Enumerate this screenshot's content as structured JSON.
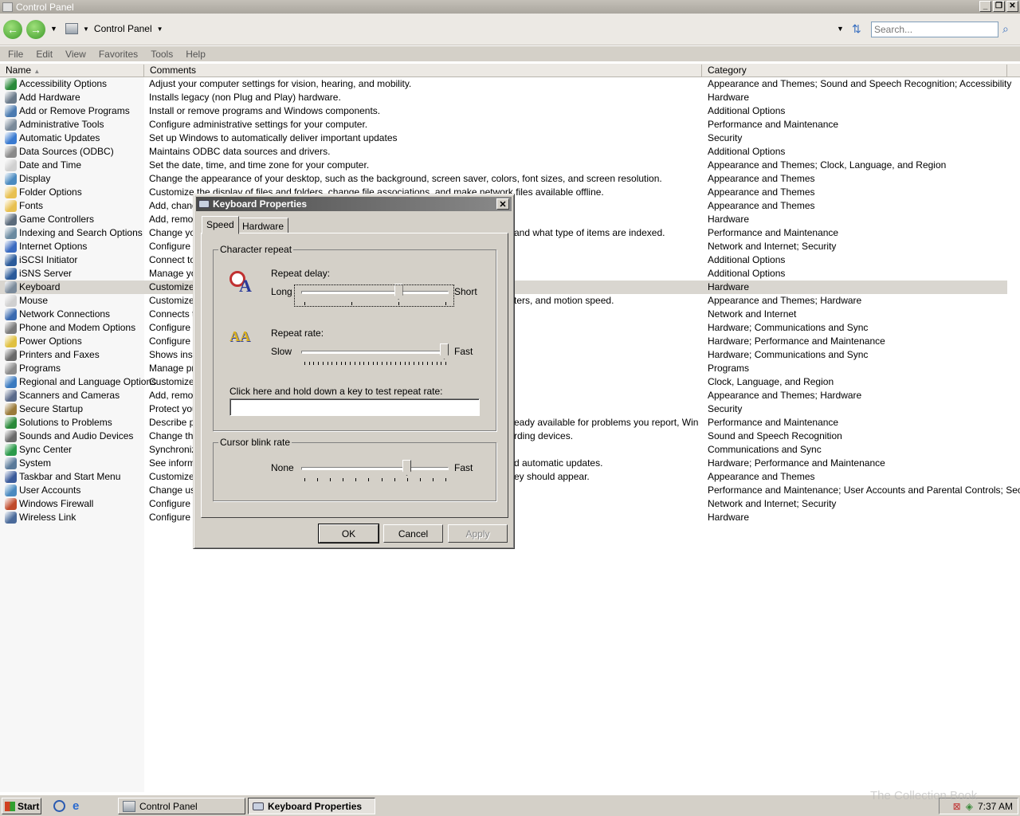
{
  "window": {
    "title": "Control Panel"
  },
  "address": {
    "path": "Control Panel",
    "search_placeholder": "Search..."
  },
  "menu": [
    "File",
    "Edit",
    "View",
    "Favorites",
    "Tools",
    "Help"
  ],
  "columns": {
    "name": "Name",
    "comments": "Comments",
    "category": "Category"
  },
  "items": [
    {
      "name": "Accessibility Options",
      "comment": "Adjust your computer settings for vision, hearing, and mobility.",
      "category": "Appearance and Themes; Sound and Speech Recognition; Accessibility",
      "color": "#2a8a3a"
    },
    {
      "name": "Add Hardware",
      "comment": "Installs legacy (non Plug and Play) hardware.",
      "category": "Hardware",
      "color": "#6a7a8a"
    },
    {
      "name": "Add or Remove Programs",
      "comment": "Install or remove programs and Windows components.",
      "category": "Additional Options",
      "color": "#4a7ab0"
    },
    {
      "name": "Administrative Tools",
      "comment": "Configure administrative settings for your computer.",
      "category": "Performance and Maintenance",
      "color": "#7a8a9a"
    },
    {
      "name": "Automatic Updates",
      "comment": "Set up Windows to automatically deliver important updates",
      "category": "Security",
      "color": "#3a7ad0"
    },
    {
      "name": "Data Sources (ODBC)",
      "comment": "Maintains ODBC data sources and drivers.",
      "category": "Additional Options",
      "color": "#8a8a8a"
    },
    {
      "name": "Date and Time",
      "comment": "Set the date, time, and time zone for your computer.",
      "category": "Appearance and Themes; Clock, Language, and Region",
      "color": "#d0d0d0"
    },
    {
      "name": "Display",
      "comment": "Change the appearance of your desktop, such as the background, screen saver, colors, font sizes, and screen resolution.",
      "category": "Appearance and Themes",
      "color": "#4a8ac0"
    },
    {
      "name": "Folder Options",
      "comment": "Customize the display of files and folders, change file associations, and make network files available offline.",
      "category": "Appearance and Themes",
      "color": "#e8c050"
    },
    {
      "name": "Fonts",
      "comment": "Add, change",
      "category": "Appearance and Themes",
      "color": "#e8c050"
    },
    {
      "name": "Game Controllers",
      "comment": "Add, remov",
      "category": "Hardware",
      "color": "#5a6a7a"
    },
    {
      "name": "Indexing and Search Options",
      "comment": "Change you",
      "comment_tail": "and what type of items are indexed.",
      "category": "Performance and Maintenance",
      "color": "#6a8aa0"
    },
    {
      "name": "Internet Options",
      "comment": "Configure y",
      "category": "Network and Internet; Security",
      "color": "#3a6ac0"
    },
    {
      "name": "iSCSI Initiator",
      "comment": "Connect to",
      "category": "Additional Options",
      "color": "#2a5a9a"
    },
    {
      "name": "iSNS Server",
      "comment": "Manage you",
      "category": "Additional Options",
      "color": "#2a5a9a"
    },
    {
      "name": "Keyboard",
      "comment": "Customize y",
      "category": "Hardware",
      "color": "#7a8a9a"
    },
    {
      "name": "Mouse",
      "comment": "Customize y",
      "comment_tail": "ters, and motion speed.",
      "category": "Appearance and Themes; Hardware",
      "color": "#d0d0d0"
    },
    {
      "name": "Network Connections",
      "comment": "Connects to",
      "category": "Network and Internet",
      "color": "#3a6ab0"
    },
    {
      "name": "Phone and Modem Options",
      "comment": "Configure y",
      "category": "Hardware; Communications and Sync",
      "color": "#7a7a7a"
    },
    {
      "name": "Power Options",
      "comment": "Configure e",
      "category": "Hardware; Performance and Maintenance",
      "color": "#e0c040"
    },
    {
      "name": "Printers and Faxes",
      "comment": "Shows insta",
      "category": "Hardware; Communications and Sync",
      "color": "#6a6a6a"
    },
    {
      "name": "Programs",
      "comment": "Manage pro",
      "category": "Programs",
      "color": "#8a8a8a"
    },
    {
      "name": "Regional and Language Options",
      "comment": "Customize s",
      "category": "Clock, Language, and Region",
      "color": "#3a7ac0"
    },
    {
      "name": "Scanners and Cameras",
      "comment": "Add, remov",
      "category": "Appearance and Themes; Hardware",
      "color": "#5a6a8a"
    },
    {
      "name": "Secure Startup",
      "comment": "Protect you",
      "category": "Security",
      "color": "#9a7a3a"
    },
    {
      "name": "Solutions to Problems",
      "comment": "Describe pr",
      "comment_tail": "eady available for problems you report, Window...",
      "category": "Performance and Maintenance",
      "color": "#2a8a3a"
    },
    {
      "name": "Sounds and Audio Devices",
      "comment": "Change the",
      "comment_tail": "rding devices.",
      "category": "Sound and Speech Recognition",
      "color": "#6a6a6a"
    },
    {
      "name": "Sync Center",
      "comment": "Synchronize",
      "category": "Communications and Sync",
      "color": "#2a9a4a"
    },
    {
      "name": "System",
      "comment": "See informa",
      "comment_tail": "d automatic updates.",
      "category": "Hardware; Performance and Maintenance",
      "color": "#5a7a9a"
    },
    {
      "name": "Taskbar and Start Menu",
      "comment": "Customize t",
      "comment_tail": "ey should appear.",
      "category": "Appearance and Themes",
      "color": "#3a5a9a"
    },
    {
      "name": "User Accounts",
      "comment": "Change use",
      "category": "Performance and Maintenance; User Accounts and Parental Controls; Security",
      "color": "#4a8ac0"
    },
    {
      "name": "Windows Firewall",
      "comment": "Configure th",
      "category": "Network and Internet; Security",
      "color": "#c04a2a"
    },
    {
      "name": "Wireless Link",
      "comment": "Configure ir",
      "category": "Hardware",
      "color": "#4a6a9a"
    }
  ],
  "selected_index": 15,
  "dialog": {
    "title": "Keyboard Properties",
    "tabs": [
      "Speed",
      "Hardware"
    ],
    "char_repeat_group": "Character repeat",
    "repeat_delay_label": "Repeat delay:",
    "repeat_delay_min": "Long",
    "repeat_delay_max": "Short",
    "repeat_delay_level": 0.67,
    "repeat_rate_label": "Repeat rate:",
    "repeat_rate_min": "Slow",
    "repeat_rate_max": "Fast",
    "repeat_rate_level": 1.0,
    "test_label": "Click here and hold down a key to test repeat rate:",
    "test_value": "",
    "cursor_group": "Cursor blink rate",
    "cursor_min": "None",
    "cursor_max": "Fast",
    "cursor_level": 0.73,
    "ok": "OK",
    "cancel": "Cancel",
    "apply": "Apply"
  },
  "taskbar": {
    "start": "Start",
    "tasks": [
      "Control Panel",
      "Keyboard Properties"
    ],
    "clock": "7:37 AM"
  },
  "watermark": "The Collection Book"
}
